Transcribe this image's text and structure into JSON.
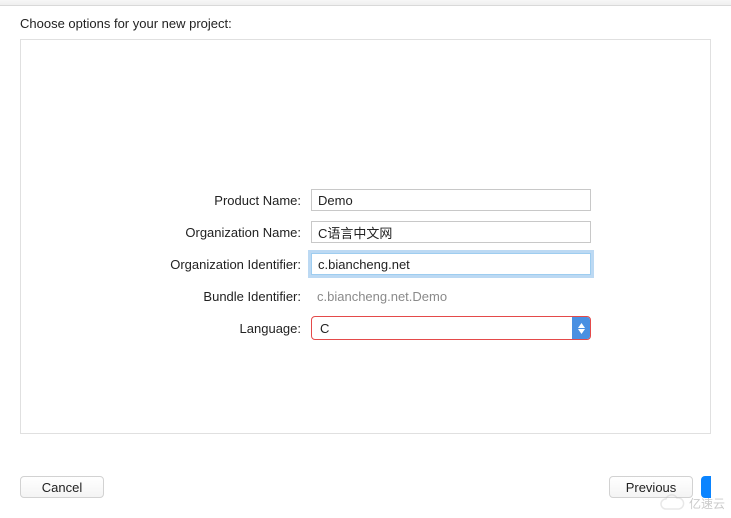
{
  "dialog": {
    "title": "Choose options for your new project:"
  },
  "form": {
    "product_name": {
      "label": "Product Name:",
      "value": "Demo"
    },
    "organization_name": {
      "label": "Organization Name:",
      "value": "C语言中文网"
    },
    "organization_identifier": {
      "label": "Organization Identifier:",
      "value": "c.biancheng.net"
    },
    "bundle_identifier": {
      "label": "Bundle Identifier:",
      "value": "c.biancheng.net.Demo"
    },
    "language": {
      "label": "Language:",
      "value": "C"
    }
  },
  "buttons": {
    "cancel": "Cancel",
    "previous": "Previous"
  },
  "watermark": {
    "text": "亿速云"
  }
}
